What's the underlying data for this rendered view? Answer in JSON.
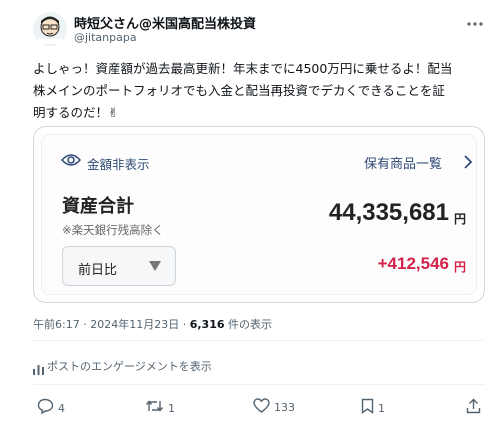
{
  "user": {
    "display_name": "時短父さん@米国高配当株投資",
    "handle": "@jitanpapa"
  },
  "tweet": {
    "line1": "よしゃっ！資産額が過去最高更新！年末までに4500万円に乗せるよ！配当",
    "line2": "株メインのポートフォリオでも入金と配当再投資でデカくできることを証",
    "line3": "明するのだ！✌"
  },
  "card": {
    "hide_amount_label": "金額非表示",
    "holdings_link": "保有商品一覧",
    "total_label": "資産合計",
    "total_note": "※楽天銀行残高除く",
    "total_value": "44,335,681",
    "currency": "円",
    "compare_select": "前日比",
    "change_value": "+412,546"
  },
  "meta": {
    "time": "午前6:17",
    "date": "2024年11月23日",
    "views": "6,316",
    "views_suffix": "件の表示"
  },
  "engagement_link": "ポストのエンゲージメントを表示",
  "actions": {
    "replies": "4",
    "reposts": "1",
    "likes": "133",
    "bookmarks": "1"
  },
  "icons": [
    "more-icon",
    "eye-icon",
    "chevron-right-icon",
    "analytics-icon",
    "reply-icon",
    "repost-icon",
    "like-icon",
    "bookmark-icon",
    "share-icon"
  ],
  "colors": {
    "link_blue": "#2f4a76",
    "change_red": "#d2214a",
    "muted": "#536471"
  }
}
